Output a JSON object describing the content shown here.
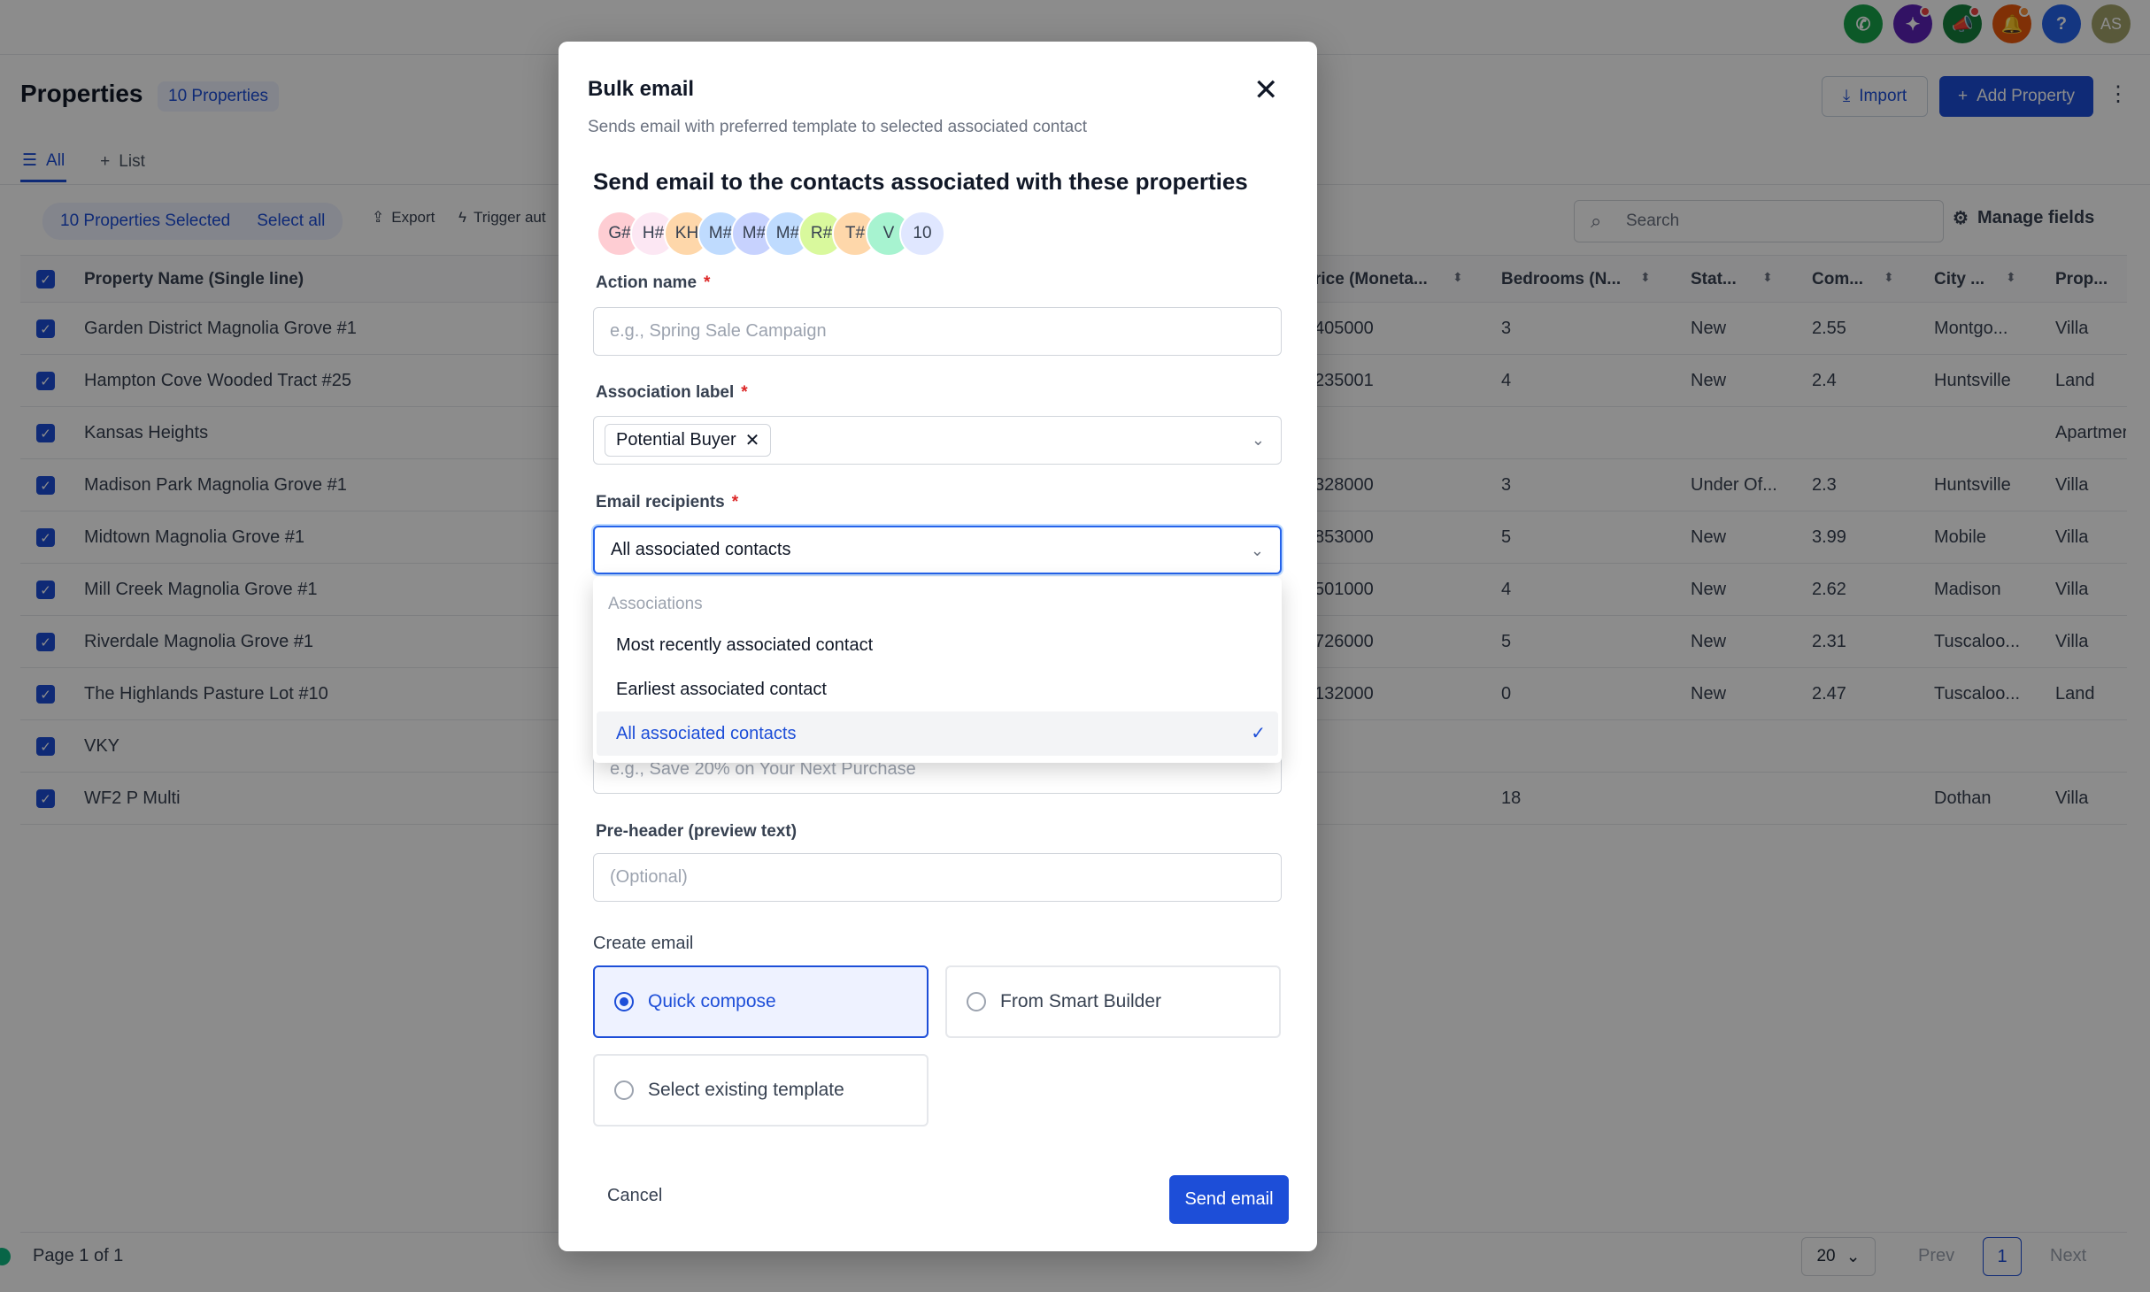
{
  "header": {
    "title": "Properties",
    "count_badge": "10 Properties",
    "import_label": "Import",
    "add_label": "Add Property",
    "avatar_initials": "AS"
  },
  "tabs": [
    {
      "label": "All"
    },
    {
      "label": "List"
    }
  ],
  "toolbar": {
    "selected_label": "10 Properties Selected",
    "select_all_label": "Select all",
    "export_label": "Export",
    "trigger_label": "Trigger aut",
    "search_placeholder": "Search",
    "manage_fields_label": "Manage fields"
  },
  "table": {
    "headers": {
      "name": "Property Name (Single line)",
      "price": "rice (Moneta...",
      "bedrooms": "Bedrooms (N...",
      "status": "Stat...",
      "com": "Com...",
      "city": "City ...",
      "type": "Prop..."
    },
    "rows": [
      {
        "name": "Garden District Magnolia Grove #1",
        "price": "405000",
        "bedrooms": "3",
        "status": "New",
        "com": "2.55",
        "city": "Montgo...",
        "type": "Villa"
      },
      {
        "name": "Hampton Cove Wooded Tract #25",
        "price": "235001",
        "bedrooms": "4",
        "status": "New",
        "com": "2.4",
        "city": "Huntsville",
        "type": "Land"
      },
      {
        "name": "Kansas Heights",
        "price": "",
        "bedrooms": "",
        "status": "",
        "com": "",
        "city": "",
        "type": "Apartmer"
      },
      {
        "name": "Madison Park Magnolia Grove #1",
        "price": "328000",
        "bedrooms": "3",
        "status": "Under Of...",
        "com": "2.3",
        "city": "Huntsville",
        "type": "Villa"
      },
      {
        "name": "Midtown Magnolia Grove #1",
        "price": "853000",
        "bedrooms": "5",
        "status": "New",
        "com": "3.99",
        "city": "Mobile",
        "type": "Villa"
      },
      {
        "name": "Mill Creek Magnolia Grove #1",
        "price": "501000",
        "bedrooms": "4",
        "status": "New",
        "com": "2.62",
        "city": "Madison",
        "type": "Villa"
      },
      {
        "name": "Riverdale Magnolia Grove #1",
        "price": "726000",
        "bedrooms": "5",
        "status": "New",
        "com": "2.31",
        "city": "Tuscaloo...",
        "type": "Villa"
      },
      {
        "name": "The Highlands Pasture Lot #10",
        "price": "132000",
        "bedrooms": "0",
        "status": "New",
        "com": "2.47",
        "city": "Tuscaloo...",
        "type": "Land"
      },
      {
        "name": "VKY",
        "price": "",
        "bedrooms": "",
        "status": "",
        "com": "",
        "city": "",
        "type": ""
      },
      {
        "name": "WF2 P Multi",
        "price": "",
        "bedrooms": "18",
        "status": "",
        "com": "",
        "city": "Dothan",
        "type": "Villa"
      }
    ]
  },
  "footer": {
    "page_info": "Page 1 of 1",
    "per_page": "20",
    "prev": "Prev",
    "page": "1",
    "next": "Next"
  },
  "modal": {
    "title": "Bulk email",
    "subtitle": "Sends email with preferred template to selected associated contact",
    "heading": "Send email to the contacts associated with these properties",
    "avatars": [
      {
        "text": "G#",
        "color": "#fecdd3"
      },
      {
        "text": "H#",
        "color": "#fce7f3"
      },
      {
        "text": "KH",
        "color": "#fed7aa"
      },
      {
        "text": "M#",
        "color": "#bfdbfe"
      },
      {
        "text": "M#",
        "color": "#c7d2fe"
      },
      {
        "text": "M#",
        "color": "#bfdbfe"
      },
      {
        "text": "R#",
        "color": "#d9f99d"
      },
      {
        "text": "T#",
        "color": "#fed7aa"
      },
      {
        "text": "V",
        "color": "#a7f3d0"
      },
      {
        "text": "10",
        "color": "#e0e7ff"
      }
    ],
    "action_name_label": "Action name",
    "action_name_placeholder": "e.g., Spring Sale Campaign",
    "association_label": "Association label",
    "association_chip": "Potential Buyer",
    "recipients_label": "Email recipients",
    "recipients_value": "All associated contacts",
    "dropdown": {
      "group_label": "Associations",
      "options": [
        {
          "label": "Most recently associated contact"
        },
        {
          "label": "Earliest associated contact"
        },
        {
          "label": "All associated contacts"
        }
      ]
    },
    "subject_placeholder": "e.g., Save 20% on Your Next Purchase",
    "preheader_label": "Pre-header (preview text)",
    "preheader_placeholder": "(Optional)",
    "create_email_label": "Create email",
    "options": [
      {
        "label": "Quick compose"
      },
      {
        "label": "From Smart Builder"
      },
      {
        "label": "Select existing template"
      }
    ],
    "cancel_label": "Cancel",
    "send_label": "Send email"
  },
  "colors": {
    "primary": "#1d4ed8",
    "overlay": "rgba(0,0,0,0.45)"
  }
}
